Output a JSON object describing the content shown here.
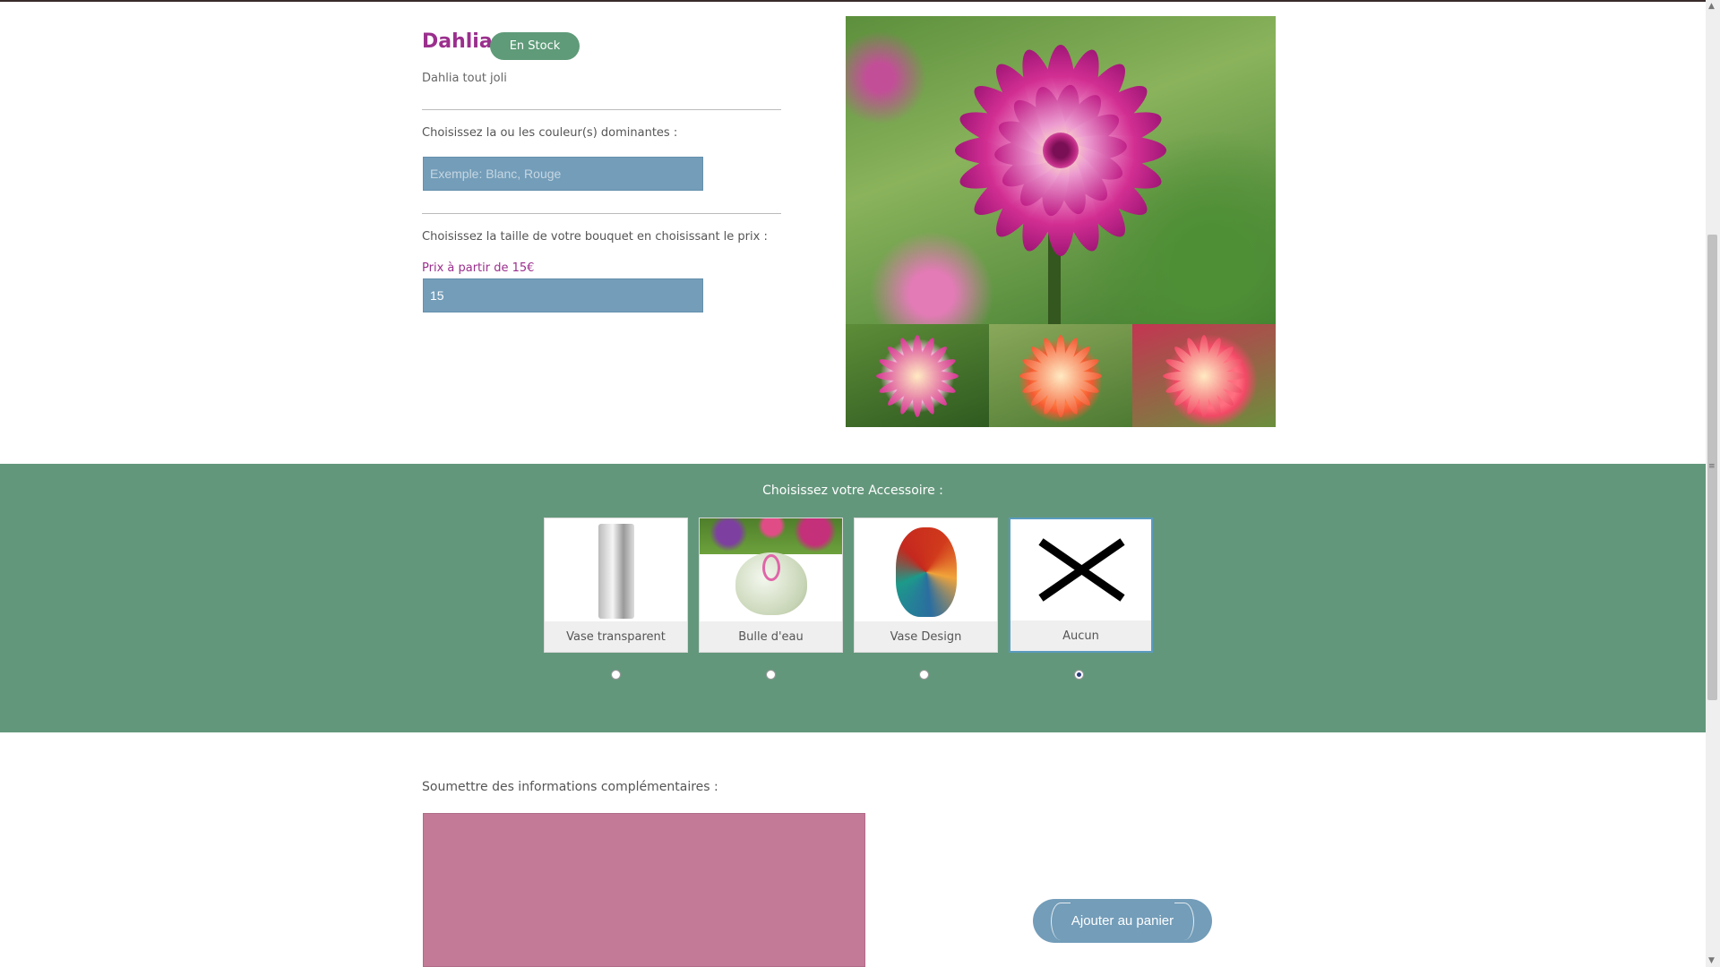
{
  "product": {
    "name": "Dahlia",
    "stock_badge": "En Stock",
    "description": "Dahlia tout joli"
  },
  "colors_section": {
    "label": "Choisissez la ou les couleur(s) dominantes :",
    "placeholder": "Exemple: Blanc, Rouge"
  },
  "size_section": {
    "label": "Choisissez la taille de votre bouquet en choisissant le prix :",
    "price_hint": "Prix à partir de 15€",
    "price_value": "15"
  },
  "accessories": {
    "title": "Choisissez votre Accessoire :",
    "items": [
      {
        "label": "Vase transparent",
        "selected": false
      },
      {
        "label": "Bulle d'eau",
        "selected": false
      },
      {
        "label": "Vase Design",
        "selected": false
      },
      {
        "label": "Aucun",
        "selected": true
      }
    ]
  },
  "extra_info": {
    "label": "Soumettre des informations complémentaires :"
  },
  "cart": {
    "button_label": "Ajouter au panier"
  },
  "colors": {
    "title": "#9b2f8d",
    "badge": "#5f9b79",
    "input": "#739db9",
    "band": "#63977c",
    "textarea": "#c27a97"
  },
  "icons": [
    "close-x-icon",
    "flower-photo",
    "vase-transparent-image",
    "bulle-eau-image",
    "vase-design-image"
  ]
}
